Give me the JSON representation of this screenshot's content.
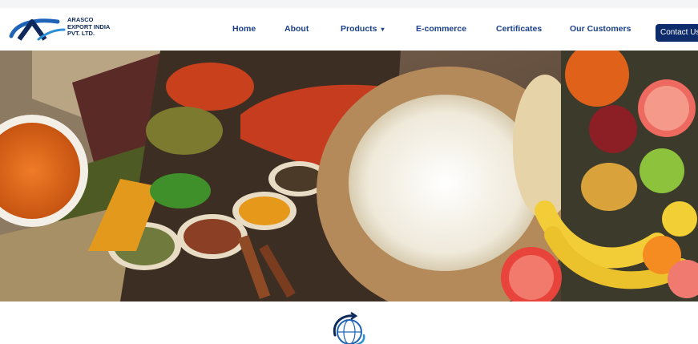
{
  "brand": {
    "name_line1": "ARASCO",
    "name_line2": "EXPORT INDIA",
    "name_line3": "PVT. LTD."
  },
  "nav": {
    "home": "Home",
    "about": "About",
    "products": "Products",
    "products_caret": "▾",
    "ecommerce": "E-commerce",
    "certificates": "Certificates",
    "customers": "Our Customers",
    "contact": "Contact Us"
  },
  "icons": {
    "logo": "arasco-logo-icon",
    "emblem": "globe-emblem-icon",
    "caret": "chevron-down-icon"
  },
  "colors": {
    "nav_text": "#1a3f8a",
    "contact_bg": "#0e2b6b",
    "brand_blue": "#1f63b8"
  }
}
